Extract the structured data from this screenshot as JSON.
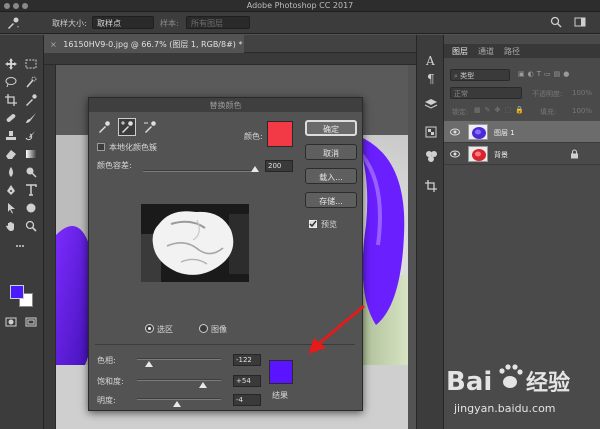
{
  "app": {
    "title": "Adobe Photoshop CC 2017"
  },
  "options_bar": {
    "sample_size_label": "取样大小:",
    "sample_size_value": "取样点",
    "sample_label": "样本:",
    "sample_value": "所有图层"
  },
  "document": {
    "tab_title": "16150HV9-0.jpg @ 66.7% (图层 1, RGB/8#) *",
    "close_glyph": "×"
  },
  "dialog": {
    "title": "替换颜色",
    "localized_clusters_label": "本地化颜色簇",
    "localized_clusters_checked": false,
    "color_label": "颜色:",
    "selected_color": "#f23a47",
    "fuzziness_label": "颜色容差:",
    "fuzziness_value": "200",
    "fuzziness_fraction": 1.0,
    "buttons": {
      "ok": "确定",
      "cancel": "取消",
      "load": "载入...",
      "save": "存储..."
    },
    "preview_label": "预览",
    "preview_checked": true,
    "view_options": [
      {
        "label": "选区",
        "selected": true
      },
      {
        "label": "图像",
        "selected": false
      }
    ],
    "hue_label": "色相:",
    "hue_value": "-122",
    "saturation_label": "饱和度:",
    "saturation_value": "+54",
    "lightness_label": "明度:",
    "lightness_value": "-4",
    "result_label": "结果",
    "result_color": "#5a14ff"
  },
  "layers_panel": {
    "tabs": [
      "图层",
      "通道",
      "路径"
    ],
    "active_tab": 0,
    "filter_label": "类型",
    "blend_mode": "正常",
    "opacity_label": "不透明度:",
    "opacity_value": "100%",
    "lock_label": "锁定:",
    "fill_label": "填充:",
    "fill_value": "100%",
    "layers": [
      {
        "name": "图层 1",
        "selected": true,
        "locked": false,
        "thumb_color": "#4a2bd6"
      },
      {
        "name": "背景",
        "selected": false,
        "locked": true,
        "thumb_color": "#d8242f"
      }
    ]
  },
  "colors": {
    "foreground": "#4a1bff",
    "background": "#ffffff"
  },
  "watermark": {
    "brand_left": "Bai",
    "brand_right": "经验",
    "url": "jingyan.baidu.com"
  }
}
